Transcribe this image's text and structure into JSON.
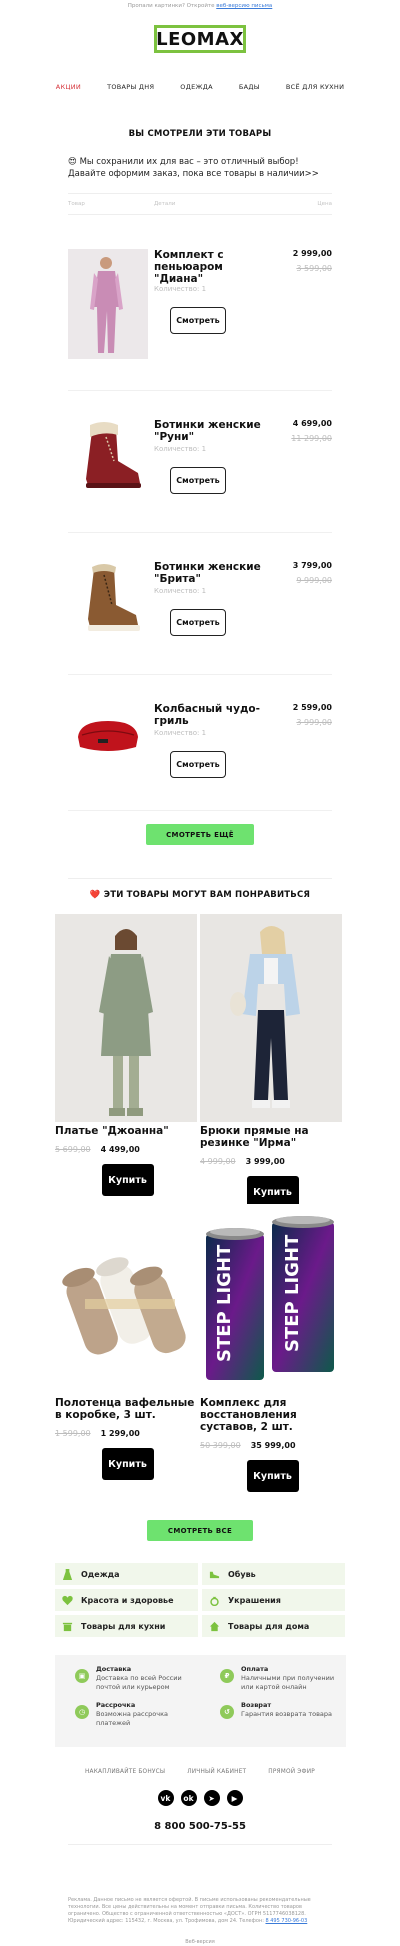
{
  "preheader": {
    "text": "Пропали картинки? Откройте",
    "link": "веб-версию письма"
  },
  "logo": "LEOMAX",
  "nav": [
    "АКЦИИ",
    "ТОВАРЫ ДНЯ",
    "ОДЕЖДА",
    "БАДЫ",
    "ВСЁ ДЛЯ КУХНИ"
  ],
  "viewed": {
    "title": "ВЫ СМОТРЕЛИ ЭТИ ТОВАРЫ",
    "intro": "😍 Мы сохранили их для вас – это отличный выбор! Давайте оформим заказ, пока все товары в наличии>>",
    "headers": {
      "product": "Товар",
      "details": "Детали",
      "price": "Цена"
    },
    "items": [
      {
        "name": "Комплект с пеньюаром \"Диана\"",
        "qty": "Количество: 1",
        "price": "2 999,00",
        "old": "3 599,00",
        "button": "Смотреть"
      },
      {
        "name": "Ботинки женские \"Руни\"",
        "qty": "Количество: 1",
        "price": "4 699,00",
        "old": "11 299,00",
        "button": "Смотреть"
      },
      {
        "name": "Ботинки женские \"Брита\"",
        "qty": "Количество: 1",
        "price": "3 799,00",
        "old": "9 999,00",
        "button": "Смотреть"
      },
      {
        "name": "Колбасный чудо-гриль",
        "qty": "Количество: 1",
        "price": "2 599,00",
        "old": "3 999,00",
        "button": "Смотреть"
      }
    ],
    "more_button": "СМОТРЕТЬ ЕЩЁ"
  },
  "recommend": {
    "title": "❤️ ЭТИ ТОВАРЫ МОГУТ ВАМ ПОНРАВИТЬСЯ",
    "items": [
      {
        "name": "Платье \"Джоанна\"",
        "old": "5 699,00",
        "price": "4 499,00",
        "button": "Купить"
      },
      {
        "name": "Брюки прямые на резинке \"Ирма\"",
        "old": "4 999,00",
        "price": "3 999,00",
        "button": "Купить"
      },
      {
        "name": "Полотенца вафельные в коробке, 3 шт.",
        "old": "1 599,00",
        "price": "1 299,00",
        "button": "Купить"
      },
      {
        "name": "Комплекс для восстановления суставов, 2 шт.",
        "old": "50 399,00",
        "price": "35 999,00",
        "button": "Купить"
      }
    ],
    "all_button": "СМОТРЕТЬ ВСЕ",
    "can_text": "STEP LIGHT"
  },
  "categories": [
    "Одежда",
    "Обувь",
    "Красота и здоровье",
    "Украшения",
    "Товары для кухни",
    "Товары для дома"
  ],
  "info": [
    {
      "title": "Доставка",
      "text": "Доставка по всей России почтой или курьером"
    },
    {
      "title": "Оплата",
      "text": "Наличными при получении или картой онлайн"
    },
    {
      "title": "Рассрочка",
      "text": "Возможна рассрочка платежей"
    },
    {
      "title": "Возврат",
      "text": "Гарантия возврата товара"
    }
  ],
  "footer_links": [
    "НАКАПЛИВАЙТЕ БОНУСЫ",
    "ЛИЧНЫЙ КАБИНЕТ",
    "ПРЯМОЙ ЭФИР"
  ],
  "social": [
    "VK",
    "OK",
    "TG",
    "YT"
  ],
  "phone": "8 800 500-75-55",
  "legal": "Реклама. Данное письмо не является офертой. В письме использованы рекомендательные технологии. Все цены действительны на момент отправки письма. Количество товаров ограничено. Общество с ограниченной ответственностью «ДОСТ». ОГРН 5117746038128. Юридический адрес: 115432, г. Москва, ул. Трофимова, дом 24. Телефон:",
  "legal_phone": "8 495 730-96-03",
  "webversion": "Веб-версия",
  "colors": {
    "accent_green": "#6ee26f",
    "logo_green": "#7cc23f",
    "nav_red": "#d6343b"
  }
}
